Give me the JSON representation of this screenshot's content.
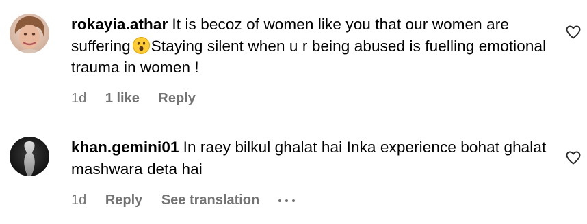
{
  "comments": [
    {
      "username": "rokayia.athar",
      "text_before_emoji": "It is becoz of women like you that our women are suffering",
      "emoji": "hushed-face-emoji",
      "text_after_emoji": "Staying silent when u r being abused is fuelling emotional trauma in women !",
      "time": "1d",
      "likes": "1 like",
      "reply_label": "Reply"
    },
    {
      "username": "khan.gemini01",
      "text": "In raey bilkul ghalat hai Inka experience bohat ghalat mashwara deta hai",
      "time": "1d",
      "reply_label": "Reply",
      "translate_label": "See translation",
      "more_icon": "more-options-icon"
    }
  ],
  "icons": {
    "like": "heart-outline-icon"
  },
  "colors": {
    "text": "#000000",
    "secondary": "#737373",
    "background": "#ffffff"
  }
}
